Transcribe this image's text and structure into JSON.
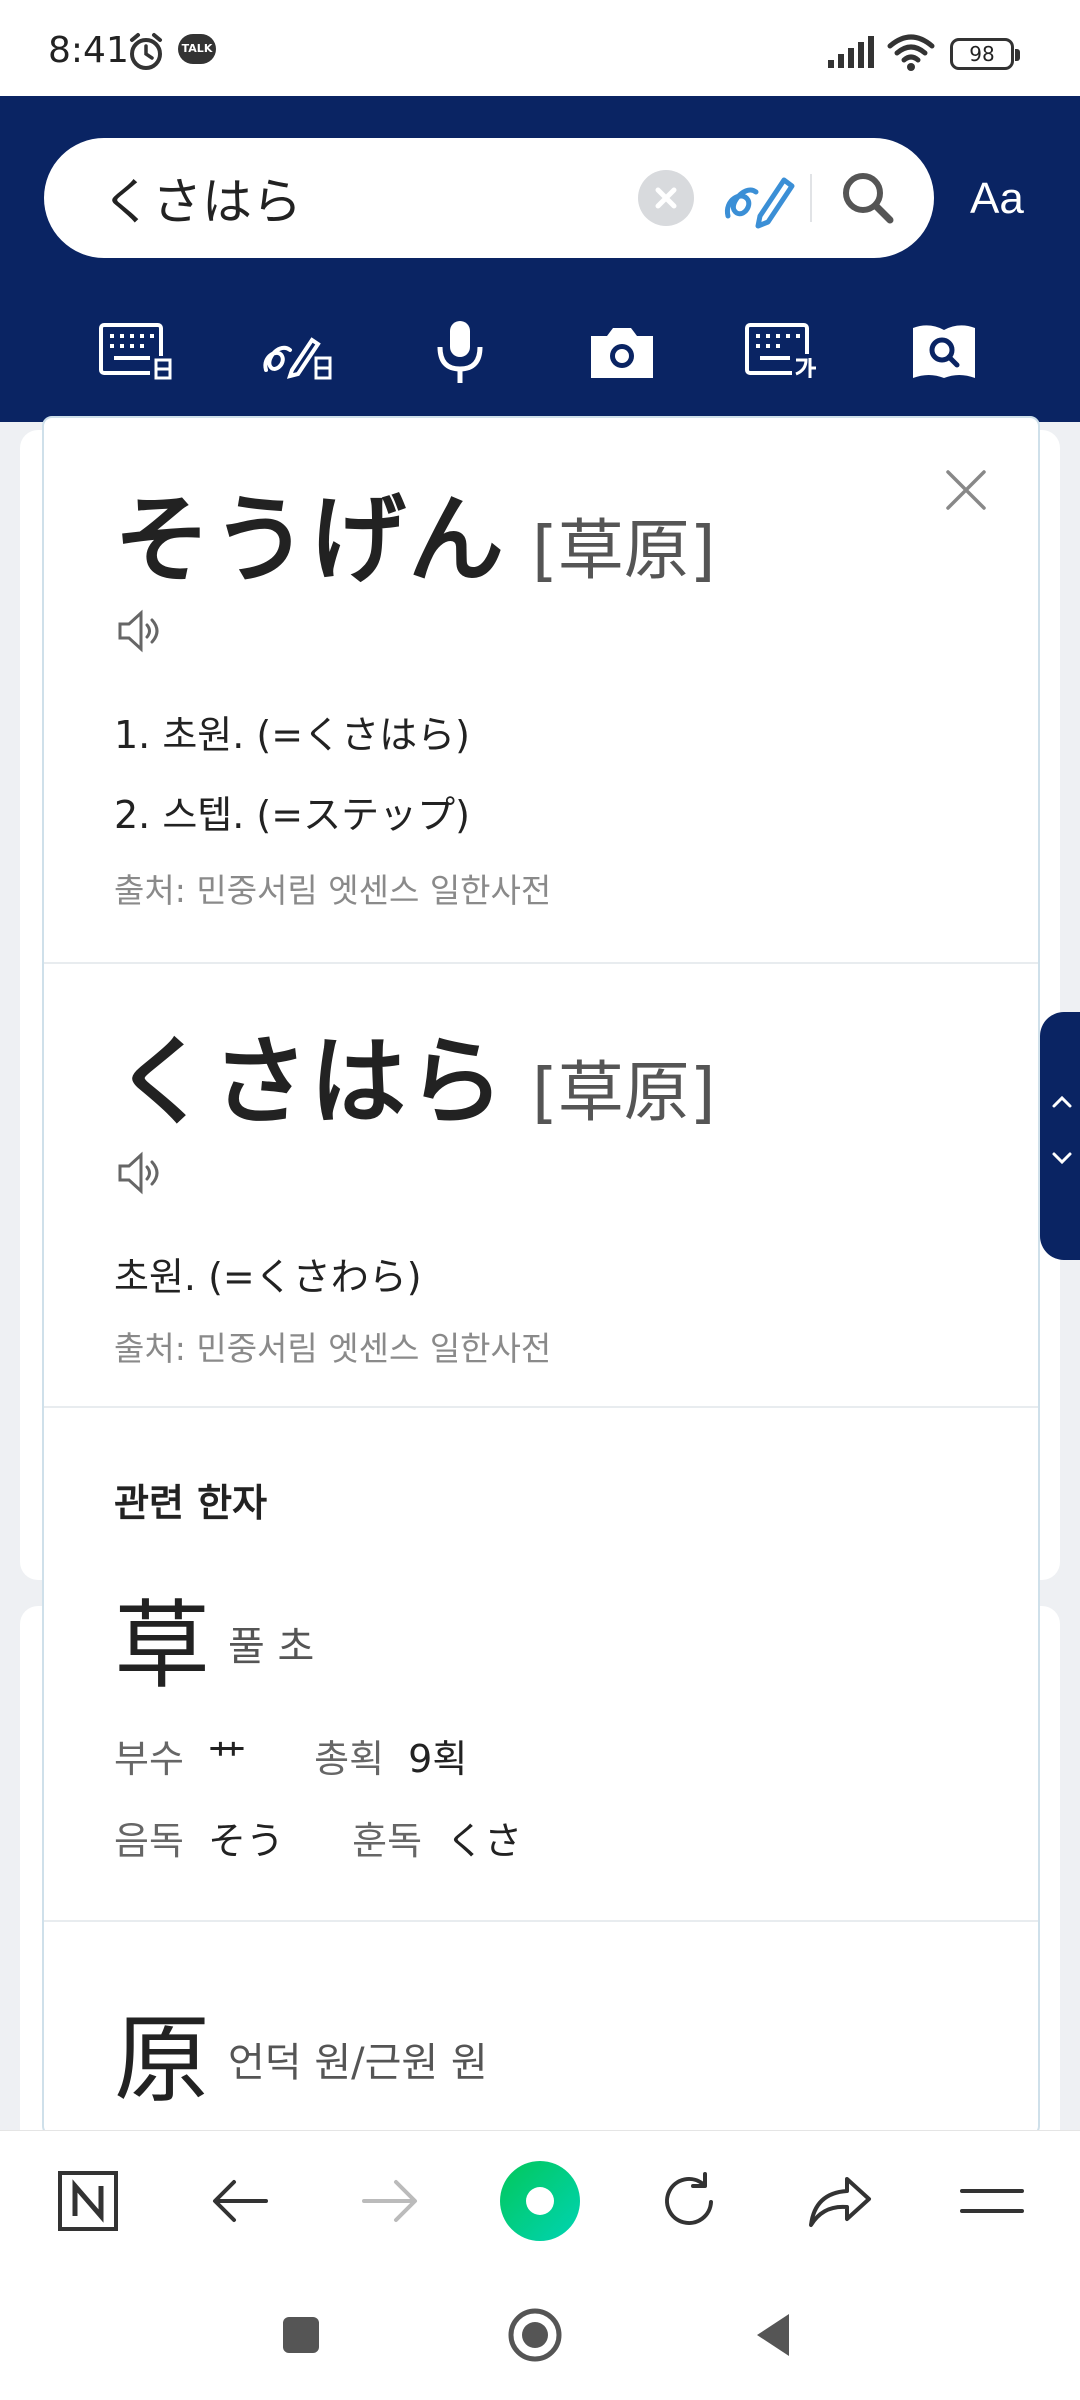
{
  "status": {
    "time": "8:41",
    "talk_badge": "TALK",
    "battery": "98"
  },
  "search": {
    "query": "くさはら",
    "font_size_label": "Aa"
  },
  "header_tools": [
    "keyboard-ja-icon",
    "handwriting-ja-icon",
    "microphone-icon",
    "camera-icon",
    "keyboard-ko-icon",
    "book-search-icon"
  ],
  "entries": [
    {
      "headword": "そうげん",
      "kanji": "[草原]",
      "definitions": [
        "1. 초원. (=くさはら)",
        "2. 스텝. (=ステップ)"
      ],
      "source": "출처: 민중서림 엣센스 일한사전"
    },
    {
      "headword": "くさはら",
      "kanji": "[草原]",
      "definitions": [
        "초원. (=くさわら)"
      ],
      "source": "출처: 민중서림 엣센스 일한사전"
    }
  ],
  "related": {
    "title": "관련 한자",
    "kanji": [
      {
        "char": "草",
        "meaning": "풀 초",
        "radical_label": "부수",
        "radical": "艹",
        "strokes_label": "총획",
        "strokes": "9획",
        "on_label": "음독",
        "on": "そう",
        "kun_label": "훈독",
        "kun": "くさ"
      },
      {
        "char": "原",
        "meaning": "언덕 원/근원 원"
      }
    ]
  },
  "browser_bar": [
    "naver-n-icon",
    "back-arrow-icon",
    "forward-arrow-icon",
    "green-dot-icon",
    "reload-icon",
    "share-icon",
    "menu-icon"
  ],
  "colors": {
    "header": "#0a2463",
    "accent_green": "#03c75a",
    "link_blue": "#3b8fd6"
  }
}
